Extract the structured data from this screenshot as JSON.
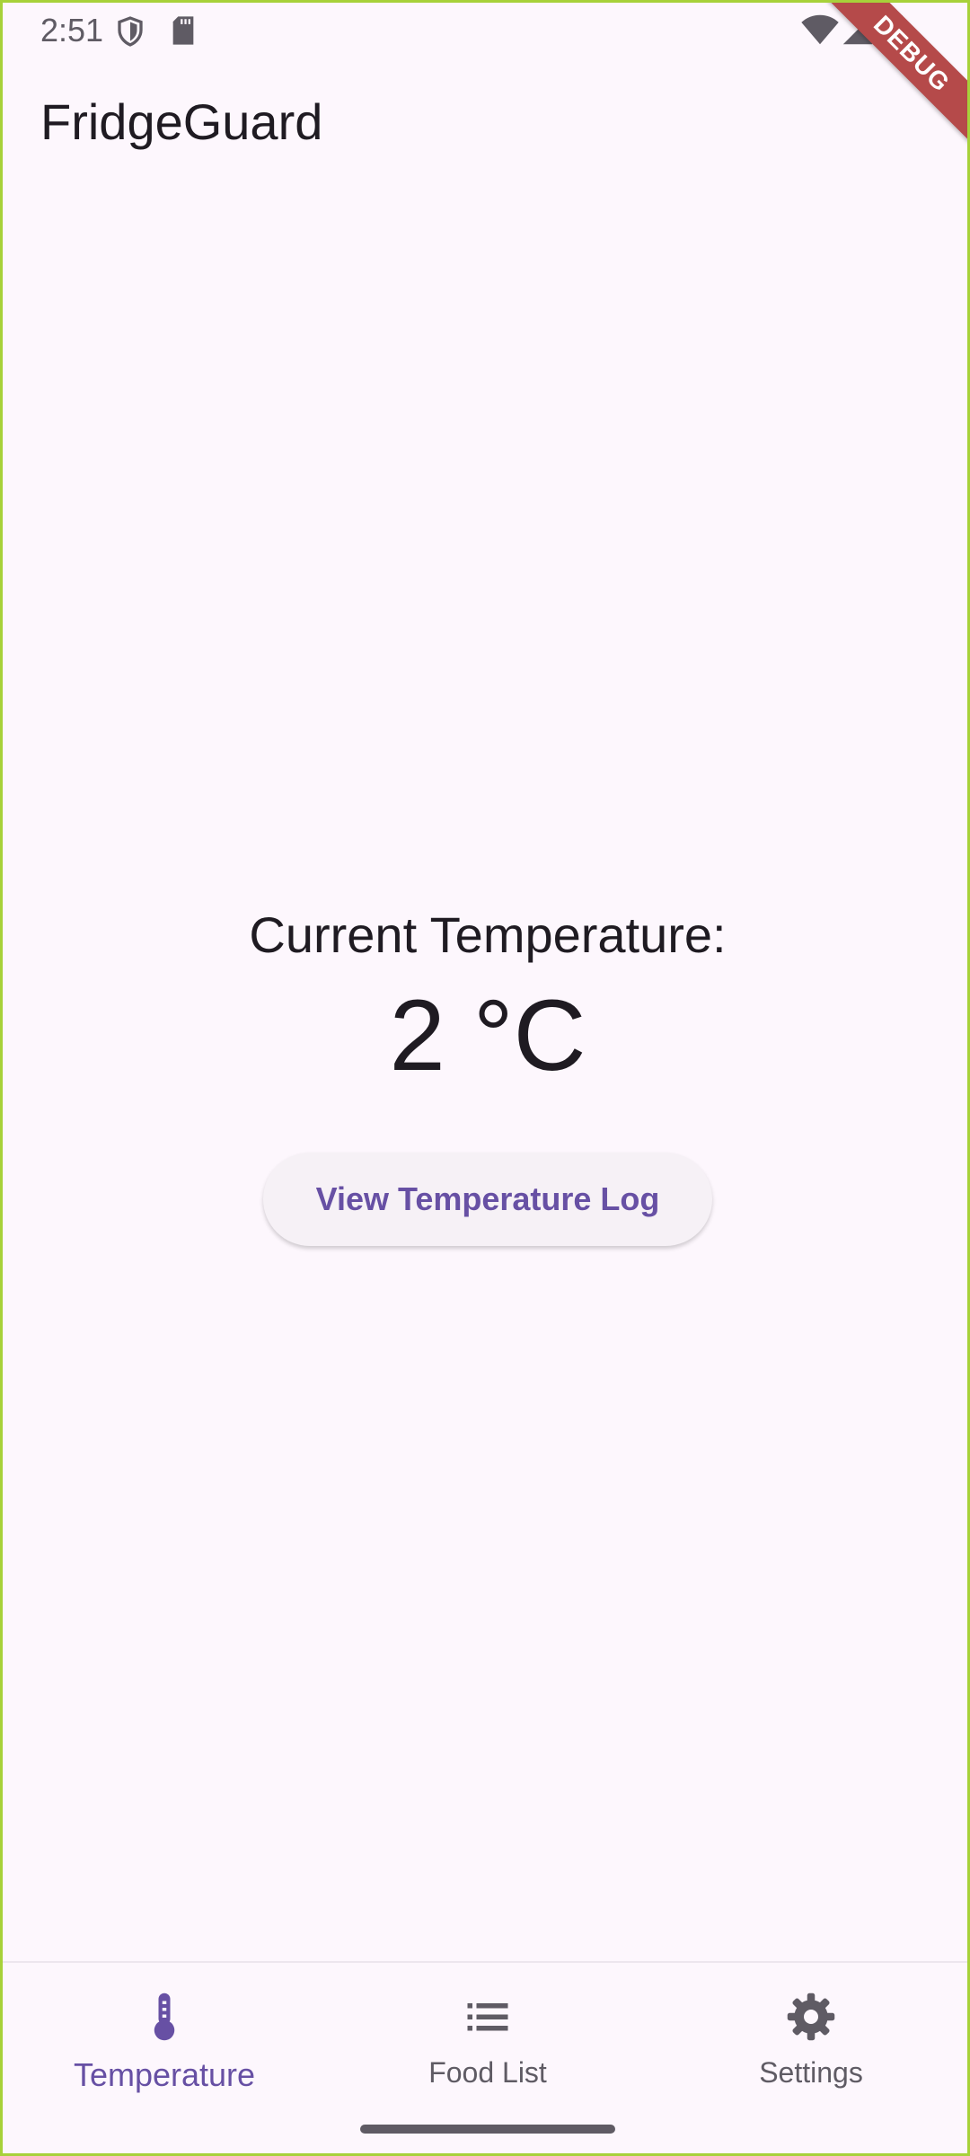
{
  "status_bar": {
    "time": "2:51"
  },
  "debug_banner": "DEBUG",
  "app_bar": {
    "title": "FridgeGuard"
  },
  "main": {
    "temperature_label": "Current Temperature:",
    "temperature_value": "2 °C",
    "log_button_label": "View Temperature Log"
  },
  "bottom_nav": {
    "items": [
      {
        "label": "Temperature",
        "icon": "thermometer-icon",
        "active": true
      },
      {
        "label": "Food List",
        "icon": "list-icon",
        "active": false
      },
      {
        "label": "Settings",
        "icon": "gear-icon",
        "active": false
      }
    ]
  },
  "colors": {
    "background": "#fdf7fd",
    "accent": "#6750a4",
    "text": "#1f1b22",
    "muted": "#5f5b64",
    "debug_ribbon": "#b54a4a",
    "frame": "#a7d13a"
  }
}
